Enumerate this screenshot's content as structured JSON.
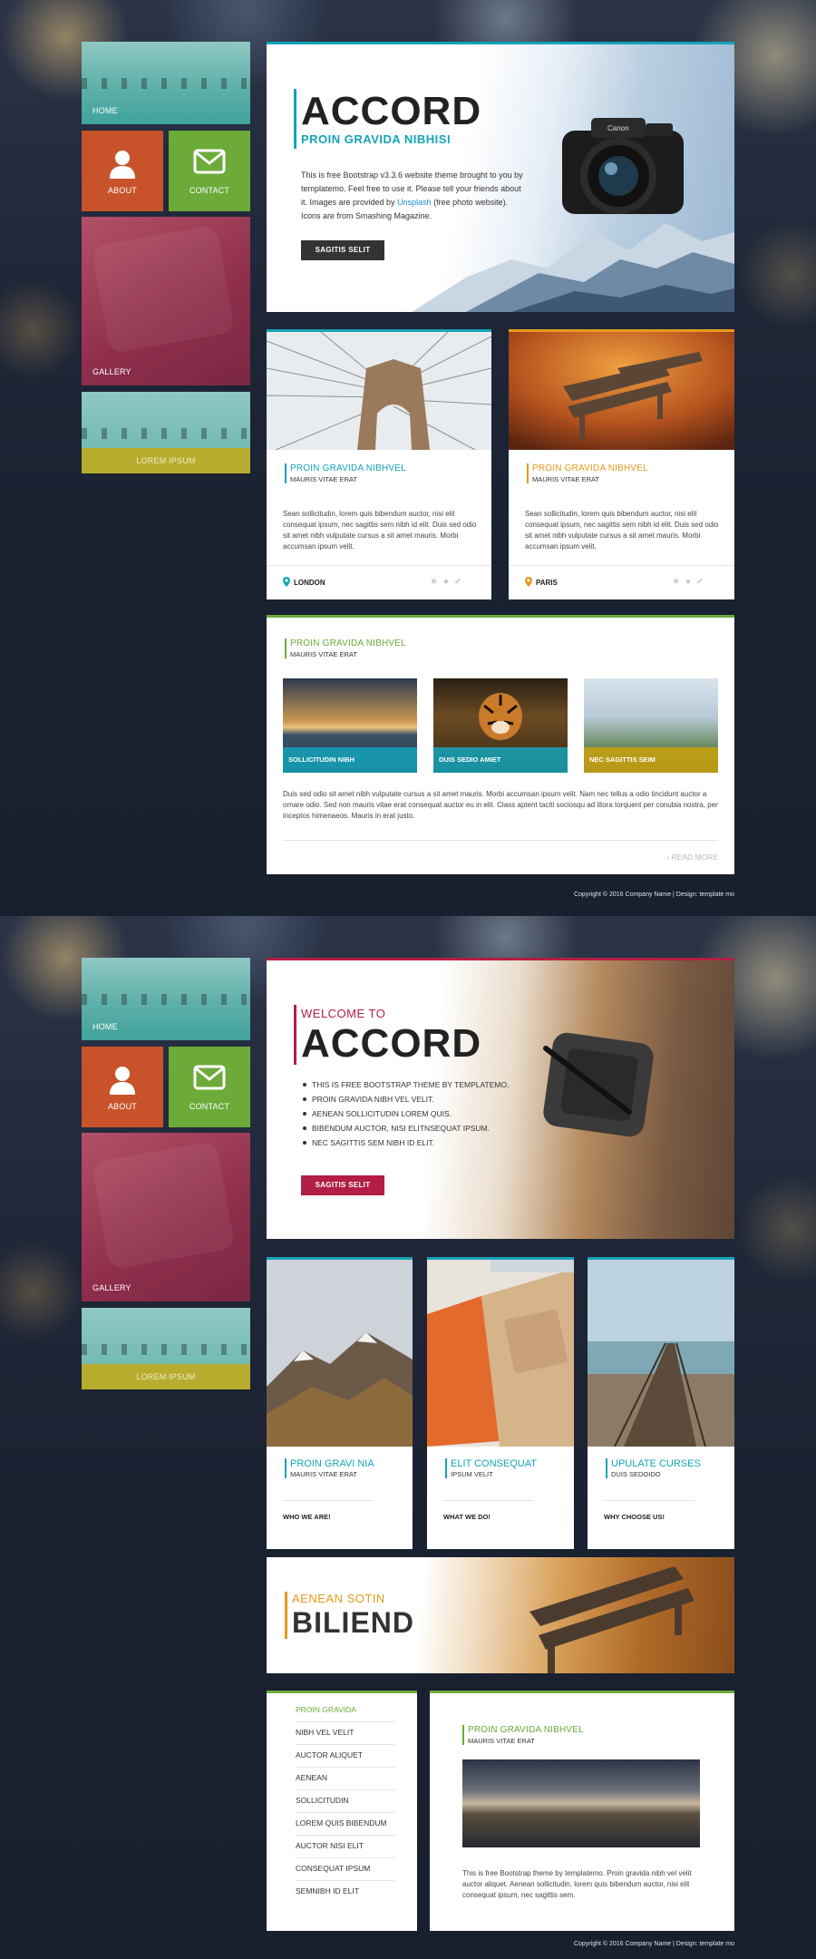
{
  "sidebar": {
    "home": "HOME",
    "about": "ABOUT",
    "contact": "CONTACT",
    "gallery": "GALLERY",
    "lorem": "LOREM IPSUM"
  },
  "colors": {
    "teal": "#14a3b8",
    "orange": "#e59a1c",
    "green": "#6cab3a",
    "crimson": "#b21e45",
    "dark": "#222222"
  },
  "page1": {
    "hero": {
      "title": "ACCORD",
      "subtitle": "PROIN GRAVIDA NIBHISI",
      "text_before_link": "This is free Bootstrap v3.3.6 website theme brought to you by templatemo. Feel free to use it. Please tell your friends about it. Images are provided by ",
      "link": "Unsplash",
      "text_after_link": " (free photo website). Icons are from Smashing Magazine.",
      "button": "SAGITIS SELIT"
    },
    "cards": [
      {
        "title": "PROIN GRAVIDA NIBHVEL",
        "subtitle": "MAURIS VITAE ERAT",
        "text": "Sean sollicitudin, lorem quis bibendum auctor, nisi elit consequat ipsum, nec sagittis sem nibh id elit. Duis sed odio sit amet nibh vulputate cursus a sit amet mauris. Morbi accumsan ipsum velit.",
        "location": "LONDON"
      },
      {
        "title": "PROIN GRAVIDA NIBHVEL",
        "subtitle": "MAURIS VITAE ERAT",
        "text": "Sean sollicitudin, lorem quis bibendum auctor, nisi elit consequat ipsum, nec sagittis sem nibh id elit. Duis sed odio sit amet nibh vulputate cursus a sit amet mauris. Morbi accumsan ipsum velit.",
        "location": "PARIS"
      }
    ],
    "gallery": {
      "title": "PROIN GRAVIDA NIBHVEL",
      "subtitle": "MAURIS VITAE ERAT",
      "thumbs": [
        "SOLLICITUDIN NIBH",
        "DUIS SEDIO AMIET",
        "NEC SAGITTIS SEIM"
      ],
      "text": "Duis sed odio sit amet nibh vulputate cursus a sit amet mauris. Morbi accumsan ipsum velit. Nam nec tellus a odio tincidunt auctor a ornare odio. Sed non mauris vitae erat consequat auctor eu in elit. Class aptent taciti sociosqu ad litora torquent per conubia nostra, per inceptos himenaeos. Mauris in erat justo.",
      "read_more": "READ MORE"
    },
    "footer": "Copyright © 2016 Company Name | Design: template mo"
  },
  "page2": {
    "hero": {
      "welcome": "WELCOME TO",
      "title": "ACCORD",
      "bullets": [
        "THIS IS FREE BOOTSTRAP THEME BY TEMPLATEMO.",
        "PROIN GRAVIDA NIBH VEL VELIT.",
        "AENEAN SOLLICITUDIN LOREM QUIS.",
        "BIBENDUM AUCTOR, NISI ELITNSEQUAT IPSUM.",
        "NEC SAGITTIS SEM NIBH ID ELIT."
      ],
      "button": "SAGITIS SELIT"
    },
    "services": [
      {
        "title": "PROIN GRAVI NIA",
        "subtitle": "MAURIS VITAE ERAT",
        "link": "WHO WE ARE!"
      },
      {
        "title": "ELIT CONSEQUAT",
        "subtitle": "IPSUM VELIT",
        "link": "WHAT WE DO!"
      },
      {
        "title": "UPULATE CURSES",
        "subtitle": "DUIS SEDOIDO",
        "link": "WHY CHOOSE US!"
      }
    ],
    "banner": {
      "small": "AENEAN SOTIN",
      "big": "BILIEND"
    },
    "nav": [
      "PROIN GRAVIDA",
      "NIBH VEL VELIT",
      "AUCTOR ALIQUET",
      "AENEAN",
      "SOLLICITUDIN",
      "LOREM QUIS BIBENDUM",
      "AUCTOR NISI ELIT",
      "CONSEQUAT IPSUM",
      "SEMNIBH ID ELIT"
    ],
    "article": {
      "title": "PROIN GRAVIDA NIBHVEL",
      "subtitle": "MAURIS VITAE ERAT",
      "text": "This is free Bootstrap theme by templatemo. Proin gravida nibh vel velit auctor aliquet. Aenean sollicitudin, lorem quis bibendum auctor, nisi elit consequat ipsum, nec sagittis sem."
    },
    "footer": "Copyright © 2016 Company Name | Design: template mo"
  }
}
